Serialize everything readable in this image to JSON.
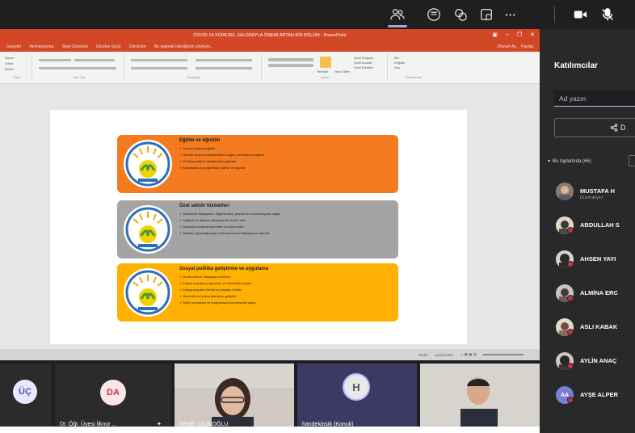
{
  "meeting_bar": {
    "buttons": [
      {
        "icon": "participants-icon",
        "label": ""
      },
      {
        "icon": "chat-icon",
        "label": ""
      },
      {
        "icon": "reactions-icon",
        "label": ""
      },
      {
        "icon": "rooms-icon",
        "label": ""
      },
      {
        "icon": "more-icon",
        "label": "···"
      },
      {
        "icon": "camera-icon",
        "label": ""
      },
      {
        "icon": "mic-off-icon",
        "label": ""
      }
    ]
  },
  "powerpoint": {
    "title": "COVID-19 KÜRESEL SALGINIYLA ÖNEMİ ARTAN BİR BÖLÜM - PowerPoint",
    "menu": [
      "Geçişler",
      "Animasyonlar",
      "Slayt Gösterisi",
      "Gözden Geçir",
      "Görünüm",
      "Ne yapmak istediğinizi söyleyin..."
    ],
    "menu_right": [
      "Oturum Aç",
      "Paylaş"
    ],
    "ribbon_groups": [
      "Pano",
      "Yazı Tipi",
      "Paragraf",
      "Çizim",
      "Düzenleme"
    ],
    "ribbon_snippets": {
      "left": [
        "Düzen",
        "Sıfırla",
        "Bölüm"
      ],
      "drawing": [
        "Yerleştir",
        "Hızlı Stiller"
      ],
      "shape": [
        "Şekil Dolgusu",
        "Şekil Anahat",
        "Şekil Efektleri"
      ],
      "edit": [
        "Bul",
        "Değiştir",
        "Seç"
      ]
    },
    "status": [
      "Notlar",
      "Açıklamalar"
    ],
    "slide": {
      "cards": [
        {
          "title": "Eğitim ve öğretim",
          "items": [
            "Sosyal çalışma eğitimi",
            "Hizmet sunan profesyonellere sağlık uzmanlarına eğitimi",
            "Profesyonellere danışmanlık yapmak",
            "Kuyruklarının programları planlar ve yapılar"
          ],
          "color": "#f47b20"
        },
        {
          "title": "Özel sektör hizmetleri",
          "items": [
            "Şirketlerin ihtiyaçlarını değerlendirir, planlar ve koordinasyonu sağlar",
            "Sağlıkla ve ailelere danışmanlık hizmet verir",
            "Sanat/kurumlarda hizmetleri koordine eder",
            "Ailelerin güvenliğini plan üretmek hizmet ihtiyaçlarını izlemek"
          ],
          "color": "#a4a4a4"
        },
        {
          "title": "Sosyal politika geliştirme ve uygulama",
          "items": [
            "Hedef kitlenin ihtiyaçlarını belirler",
            "İhtiyaç duyulan programları ve hizmetleri planlar",
            "İhtiyaç duyulan hizmet ve yasaları belirler",
            "Hizmetin ve iş akış planlarını geliştirir",
            "Diğer kurumlara ve programlara danışmanlık yapar"
          ],
          "color": "#ffb000"
        }
      ]
    }
  },
  "participants_panel": {
    "title": "Katılımcılar",
    "search_placeholder": "Ad yazın",
    "share_label": "D",
    "section_label": "Bu toplantıda (66)",
    "participants": [
      {
        "name": "MUSTAFA H",
        "role": "Düzenleyici"
      },
      {
        "name": "ABDULLAH S",
        "role": ""
      },
      {
        "name": "AHSEN YAYI",
        "role": ""
      },
      {
        "name": "ALMİNA ERC",
        "role": ""
      },
      {
        "name": "ASLI KABAK",
        "role": ""
      },
      {
        "name": "AYLİN ANAÇ",
        "role": ""
      },
      {
        "name": "AYŞE ALPER",
        "role": ""
      }
    ],
    "avatar_initials": {
      "ayse": "AA"
    }
  },
  "video_strip": {
    "tiles": [
      {
        "initials": "ÜÇ",
        "name": ""
      },
      {
        "initials": "DA",
        "name": "Dr. Öğr. Üyesi İlknur ..."
      },
      {
        "initials": "",
        "name": "NEŞE UZUNOĞLU"
      },
      {
        "initials": "H",
        "name": "handekinsik (Konuk)"
      },
      {
        "initials": "",
        "name": ""
      }
    ]
  }
}
